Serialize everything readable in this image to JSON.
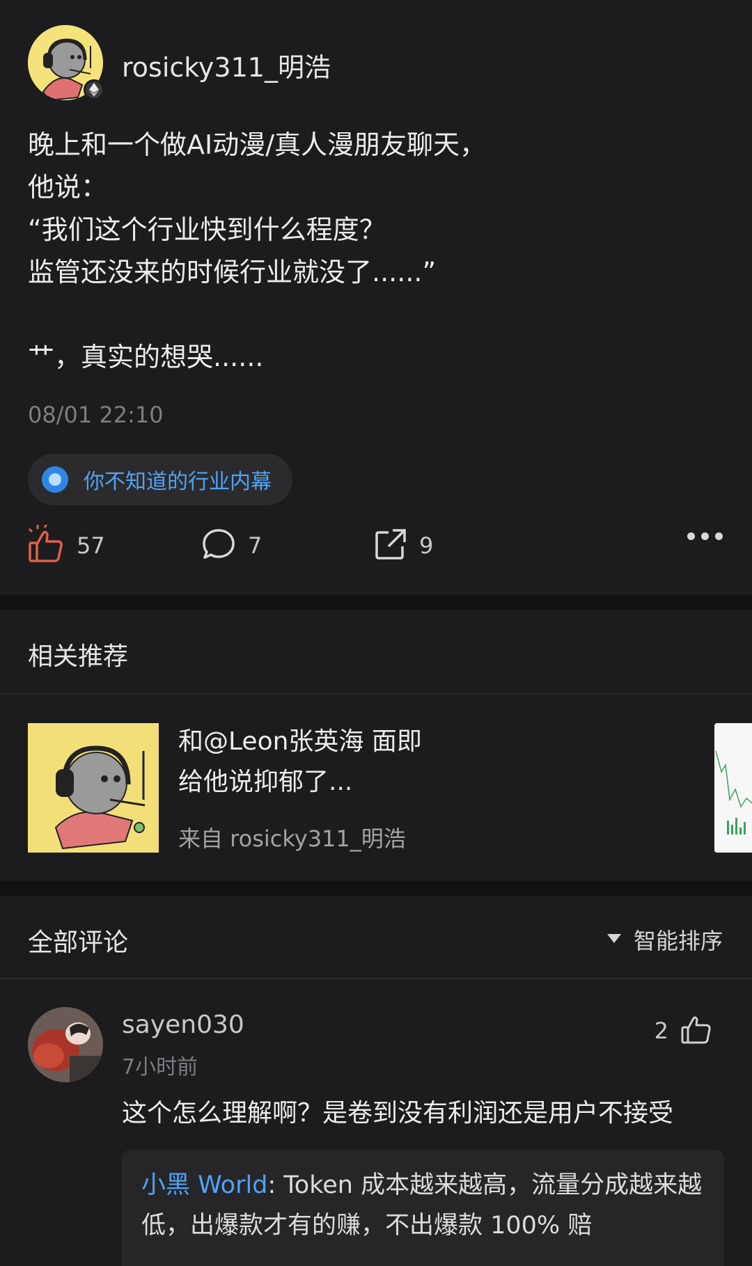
{
  "post": {
    "username": "rosicky311_明浩",
    "text": "晚上和一个做AI动漫/真人漫朋友聊天，\n他说：\n“我们这个行业快到什么程度？\n监管还没来的时候行业就没了......”\n\n艹，真实的想哭......",
    "time": "08/01 22:10",
    "topic": "你不知道的行业内幕",
    "like_count": "57",
    "comment_count": "7",
    "share_count": "9"
  },
  "related": {
    "section_title": "相关推荐",
    "items": [
      {
        "title": "和@Leon张英海 面即\n给他说抑郁了...",
        "from": "来自 rosicky311_明浩"
      }
    ]
  },
  "comments_section": {
    "title": "全部评论",
    "sort_label": "智能排序",
    "items": [
      {
        "user": "sayen030",
        "time": "7小时前",
        "likes": "2",
        "text": "这个怎么理解啊？是卷到没有利润还是用户不接受",
        "reply": {
          "user": "小黑 World",
          "sep": ": ",
          "text": "Token 成本越来越高，流量分成越来越低，出爆款才有的赚，不出爆款 100% 赔"
        }
      }
    ]
  },
  "colors": {
    "background": "#1c1c1e",
    "section_gap": "#111112",
    "accent_blue": "#4ea3f5",
    "like_red": "#e0604a"
  },
  "icons": [
    "ethereum-icon",
    "thumbs-up-icon",
    "comment-bubble-icon",
    "share-icon",
    "more-icon",
    "caret-down-icon"
  ]
}
